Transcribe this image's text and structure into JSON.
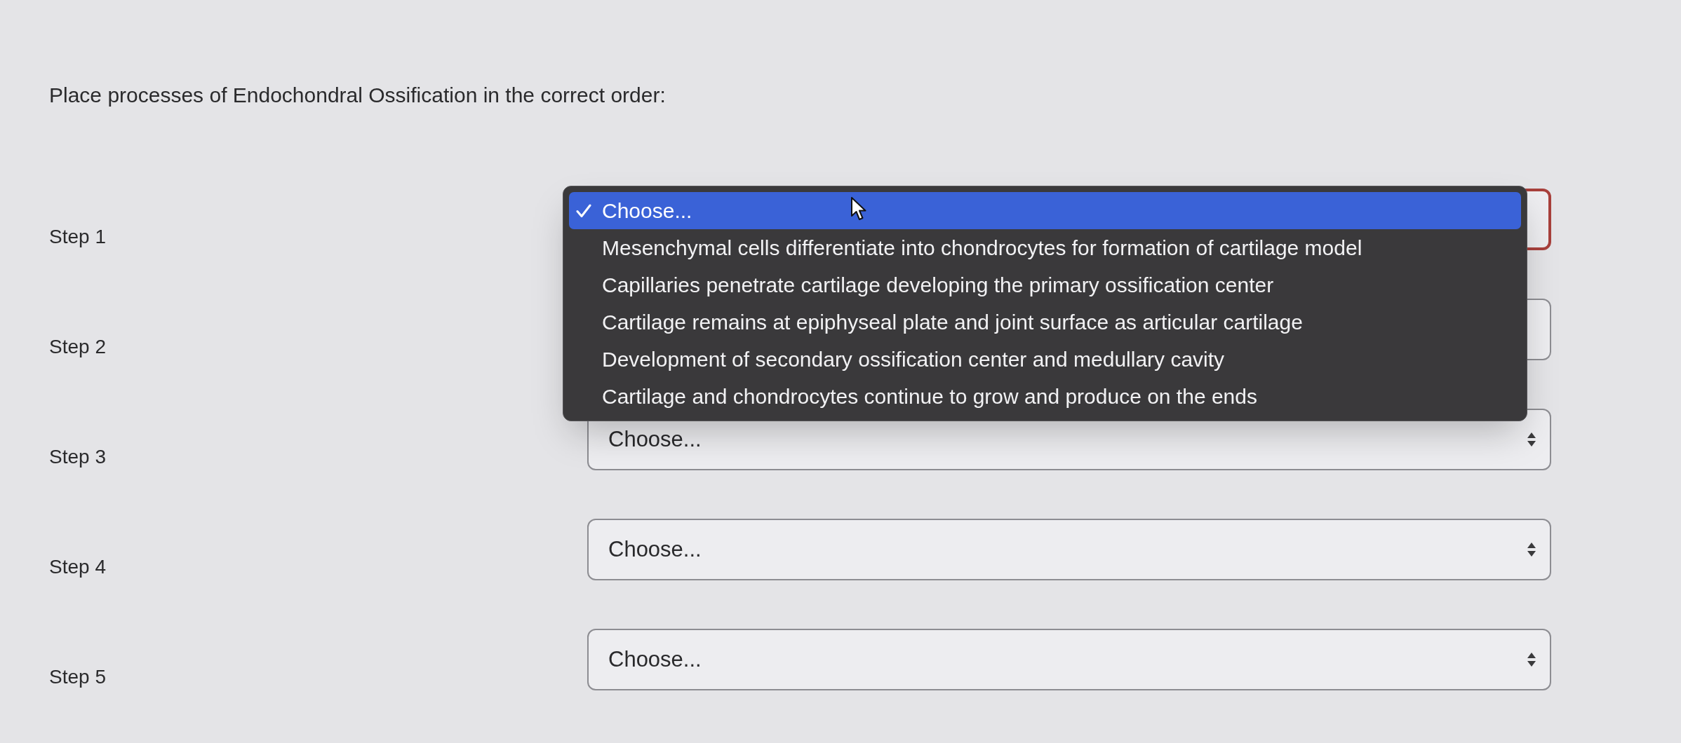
{
  "prompt": "Place processes of Endochondral Ossification in the correct order:",
  "steps": [
    {
      "label": "Step 1",
      "open": true
    },
    {
      "label": "Step 2",
      "open": false
    },
    {
      "label": "Step 3",
      "open": false,
      "value": "Choose..."
    },
    {
      "label": "Step 4",
      "open": false,
      "value": "Choose..."
    },
    {
      "label": "Step 5",
      "open": false,
      "value": "Choose..."
    }
  ],
  "dropdown_menu": {
    "options": [
      {
        "label": "Choose...",
        "selected": true
      },
      {
        "label": "Mesenchymal cells differentiate into chondrocytes for formation of cartilage model",
        "selected": false
      },
      {
        "label": "Capillaries penetrate cartilage developing the primary ossification center",
        "selected": false
      },
      {
        "label": "Cartilage remains at epiphyseal plate and joint surface as articular cartilage",
        "selected": false
      },
      {
        "label": "Development of secondary ossification center and medullary cavity",
        "selected": false
      },
      {
        "label": "Cartilage and chondrocytes continue to grow and produce on the ends",
        "selected": false
      }
    ]
  }
}
